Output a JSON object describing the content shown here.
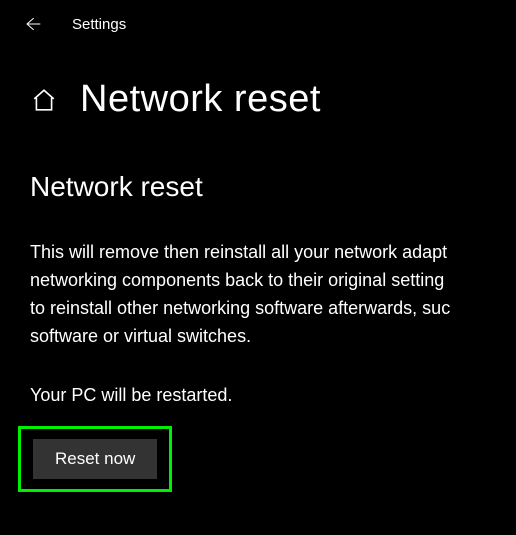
{
  "header": {
    "app_title": "Settings"
  },
  "page": {
    "title": "Network reset"
  },
  "content": {
    "section_heading": "Network reset",
    "description_line1": "This will remove then reinstall all your network adapt",
    "description_line2": "networking components back to their original setting",
    "description_line3": "to reinstall other networking software afterwards, suc",
    "description_line4": "software or virtual switches.",
    "restart_notice": "Your PC will be restarted.",
    "reset_button_label": "Reset now"
  },
  "colors": {
    "highlight_border": "#00ef00",
    "button_bg": "#333333"
  }
}
